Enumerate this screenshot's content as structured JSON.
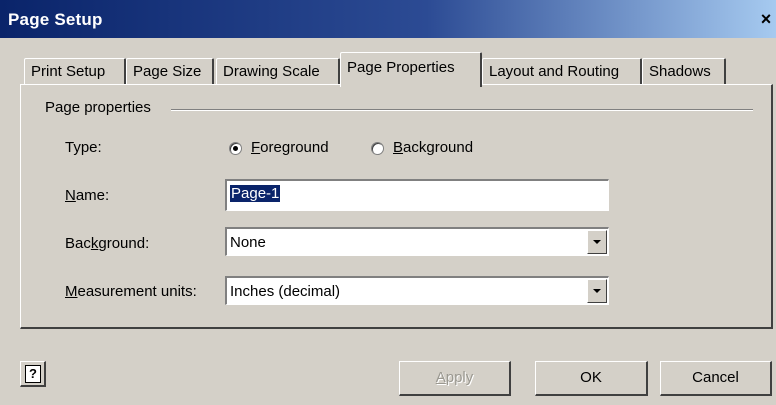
{
  "window": {
    "title": "Page Setup",
    "close_glyph": "×"
  },
  "tabs": [
    {
      "label": "Print Setup",
      "active": false
    },
    {
      "label": "Page Size",
      "active": false
    },
    {
      "label": "Drawing Scale",
      "active": false
    },
    {
      "label": "Page Properties",
      "active": true
    },
    {
      "label": "Layout and Routing",
      "active": false
    },
    {
      "label": "Shadows",
      "active": false
    }
  ],
  "page_properties": {
    "group_label": "Page properties",
    "type": {
      "label": "Type:",
      "options": [
        {
          "accel": "F",
          "rest": "oreground",
          "selected": true
        },
        {
          "accel": "B",
          "rest": "ackground",
          "selected": false
        }
      ]
    },
    "name": {
      "label_accel": "N",
      "label_rest": "ame:",
      "value": "Page-1"
    },
    "background": {
      "label_pre": "Bac",
      "label_accel": "k",
      "label_rest": "ground:",
      "value": "None"
    },
    "measurement_units": {
      "label_accel": "M",
      "label_rest": "easurement units:",
      "value": "Inches (decimal)"
    }
  },
  "buttons": {
    "help_icon": "?",
    "apply_accel": "A",
    "apply_rest": "pply",
    "ok": "OK",
    "cancel": "Cancel"
  },
  "colors": {
    "dialog_face": "#d4d0c8",
    "titlebar_start": "#0a246a",
    "selection": "#0a246a"
  }
}
